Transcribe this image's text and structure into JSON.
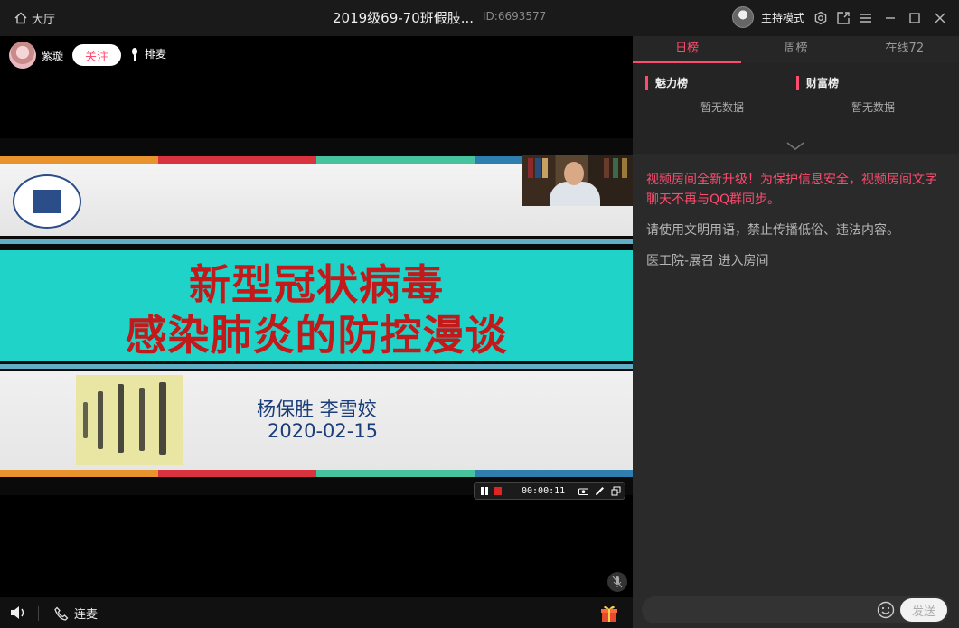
{
  "titlebar": {
    "home_label": "大厅",
    "title": "2019级69-70班假肢...",
    "room_id": "ID:6693577",
    "host_mode": "主持模式"
  },
  "anchor": {
    "name": "紫璇",
    "follow_label": "关注",
    "queue_label": "排麦"
  },
  "slide": {
    "title_line1": "新型冠状病毒",
    "title_line2": "感染肺炎的防控漫谈",
    "authors": "杨保胜  李雪姣",
    "date": "2020-02-15",
    "stripe_colors": [
      "#e8932e",
      "#d8333f",
      "#46c29c",
      "#2e7fb0"
    ],
    "band_color": "#1fd3c9",
    "title_color": "#c21a1a"
  },
  "recording": {
    "time": "00:00:11"
  },
  "bottombar": {
    "lianmai_label": "连麦"
  },
  "panel": {
    "tabs": [
      {
        "label": "日榜",
        "active": true
      },
      {
        "label": "周榜",
        "active": false
      },
      {
        "label": "在线72",
        "active": false
      }
    ],
    "charm": {
      "title": "魅力榜",
      "empty": "暂无数据"
    },
    "wealth": {
      "title": "财富榜",
      "empty": "暂无数据"
    },
    "messages": {
      "notice": "视频房间全新升级！为保护信息安全，视频房间文字聊天不再与QQ群同步。",
      "rule": "请使用文明用语，禁止传播低俗、违法内容。",
      "enter": "医工院-展召 进入房间"
    },
    "input": {
      "placeholder": "",
      "send_label": "发送"
    },
    "accent": "#ff4b6e"
  }
}
